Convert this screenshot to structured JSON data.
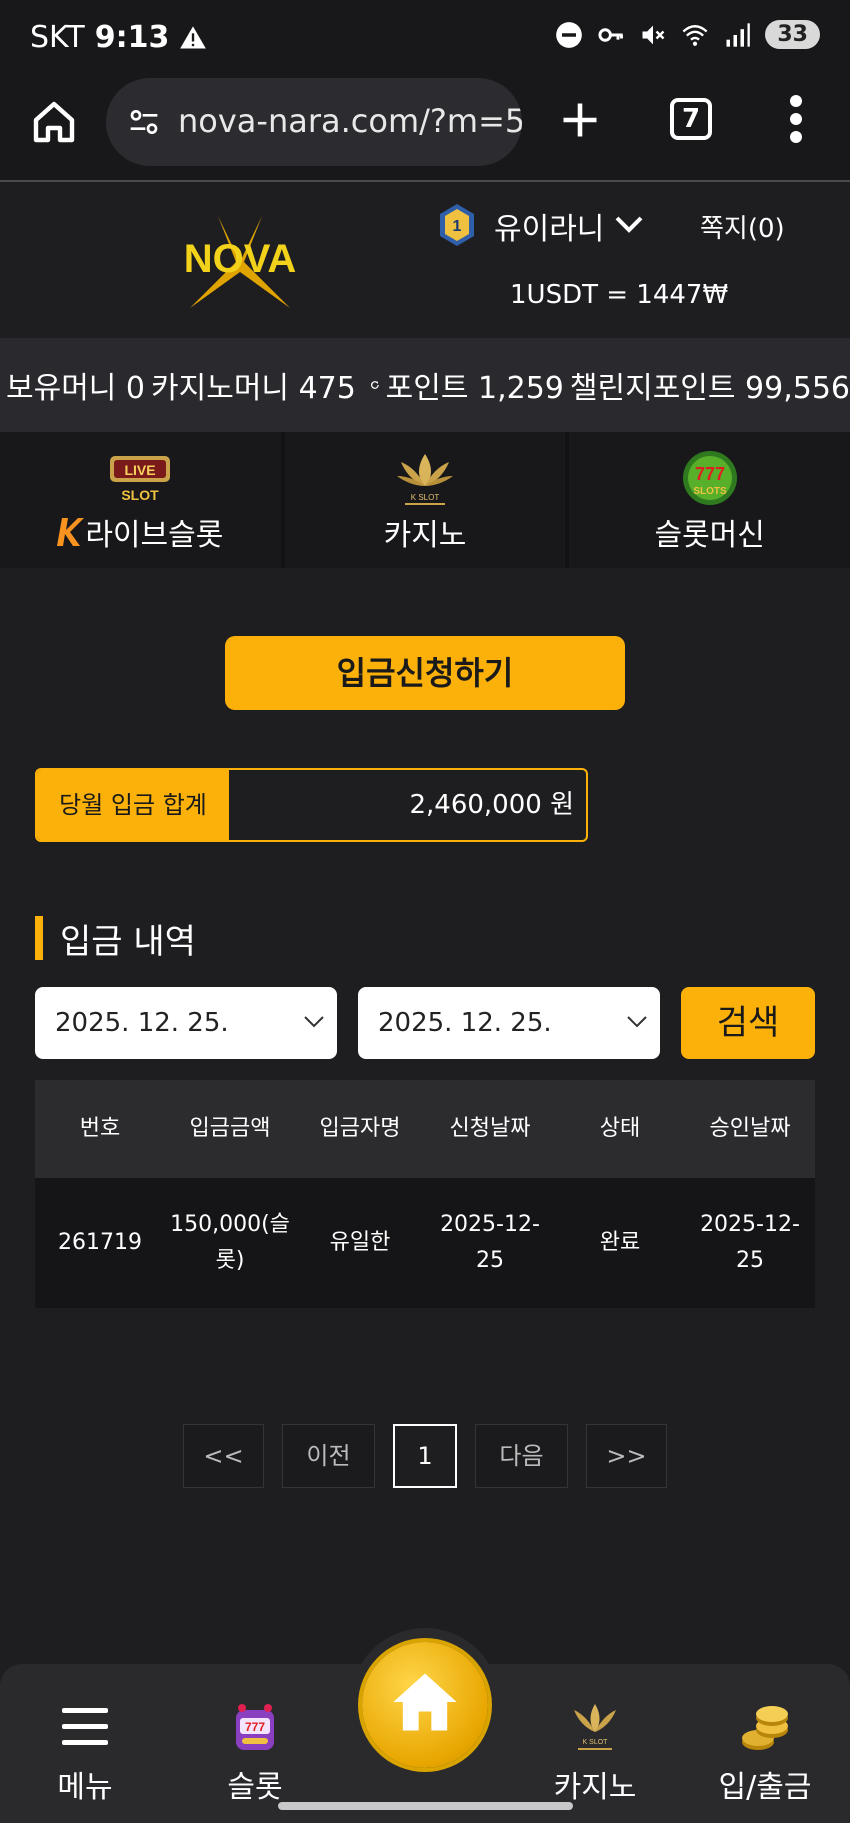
{
  "status_bar": {
    "carrier": "SKT",
    "time": "9:13",
    "battery": "33"
  },
  "browser": {
    "url": "nova-nara.com/?m=5",
    "tab_count": "7"
  },
  "header": {
    "logo_text": "NOVA",
    "username": "유이라니",
    "messages": "쪽지(0)",
    "exchange_rate": "1USDT = 1447₩"
  },
  "balances": {
    "holding": "보유머니 0",
    "casino": "카지노머니 475",
    "points": "포인트 1,259",
    "challenge": "챌린지포인트 99,556"
  },
  "game_tabs": [
    {
      "label": "라이브슬롯",
      "icon": "live-slot-icon"
    },
    {
      "label": "카지노",
      "icon": "k-slot-lotus-icon"
    },
    {
      "label": "슬롯머신",
      "icon": "777-slots-icon"
    }
  ],
  "deposit_request_label": "입금신청하기",
  "monthly_total": {
    "label": "당월 입금 합계",
    "value": "2,460,000 원"
  },
  "history": {
    "title": "입금 내역",
    "date_from": "2025. 12. 25.",
    "date_to": "2025. 12. 25.",
    "search_label": "검색",
    "columns": [
      "번호",
      "입금금액",
      "입금자명",
      "신청날짜",
      "상태",
      "승인날짜"
    ],
    "rows": [
      [
        "261719",
        "150,000(슬롯)",
        "유일한",
        "2025-12-25",
        "완료",
        "2025-12-25"
      ]
    ]
  },
  "pagination": {
    "first": "<<",
    "prev": "이전",
    "current": "1",
    "next": "다음",
    "last": ">>"
  },
  "bottom_nav": {
    "menu": "메뉴",
    "slot": "슬롯",
    "casino": "카지노",
    "deposit_withdraw": "입/출금"
  },
  "colors": {
    "accent": "#fbb109",
    "background": "#1e1e21"
  }
}
